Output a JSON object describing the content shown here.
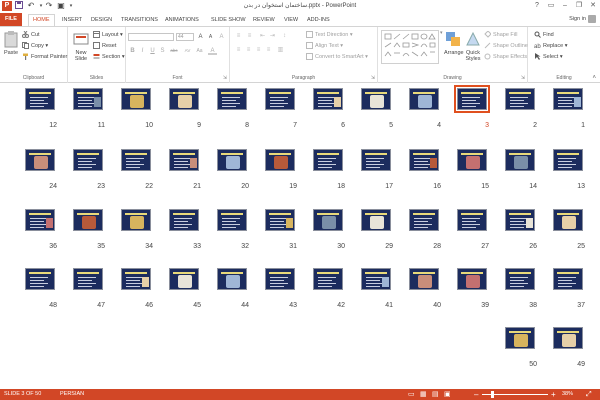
{
  "window": {
    "title": "ساختمان استخوان در بدن.pptx - PowerPoint",
    "help": "?",
    "minimize": "–",
    "restore": "❐",
    "close": "✕",
    "undo": "↶",
    "redo": "↷",
    "start": "▣"
  },
  "tabs": [
    "FILE",
    "HOME",
    "INSERT",
    "DESIGN",
    "TRANSITIONS",
    "ANIMATIONS",
    "SLIDE SHOW",
    "REVIEW",
    "VIEW",
    "ADD-INS"
  ],
  "active_tab": "HOME",
  "signin": "Sign in",
  "ribbon": {
    "clipboard": {
      "label": "Clipboard",
      "paste": "Paste",
      "cut": "Cut",
      "copy": "Copy",
      "format_painter": "Format Painter"
    },
    "slides": {
      "label": "Slides",
      "new_slide": "New",
      "new_slide2": "Slide",
      "layout": "Layout",
      "reset": "Reset",
      "section": "Section"
    },
    "font": {
      "label": "Font",
      "size": "44",
      "bold": "B",
      "italic": "I",
      "underline": "U",
      "strike": "S",
      "shadow": "abc",
      "spacing": "AV",
      "case": "Aa",
      "color": "A",
      "grow": "A",
      "shrink": "A",
      "clear": "A"
    },
    "paragraph": {
      "label": "Paragraph",
      "text_direction": "Text Direction",
      "align_text": "Align Text",
      "smartart": "Convert to SmartArt"
    },
    "drawing": {
      "label": "Drawing",
      "arrange": "Arrange",
      "quick_styles": "Quick",
      "quick_styles2": "Styles",
      "shape_fill": "Shape Fill",
      "shape_outline": "Shape Outline",
      "shape_effects": "Shape Effects"
    },
    "editing": {
      "label": "Editing",
      "find": "Find",
      "replace": "Replace",
      "select": "Select"
    }
  },
  "slides": {
    "selected": 3,
    "numbers": [
      "1",
      "2",
      "3",
      "4",
      "5",
      "6",
      "7",
      "8",
      "9",
      "10",
      "11",
      "12",
      "13",
      "14",
      "15",
      "16",
      "17",
      "18",
      "19",
      "20",
      "21",
      "22",
      "23",
      "24",
      "25",
      "26",
      "27",
      "28",
      "29",
      "30",
      "31",
      "32",
      "33",
      "34",
      "35",
      "36",
      "37",
      "38",
      "39",
      "40",
      "41",
      "42",
      "43",
      "44",
      "45",
      "46",
      "47",
      "48",
      "49",
      "50"
    ]
  },
  "status": {
    "slide_of": "SLIDE 3 OF 50",
    "language": "PERSIAN",
    "zoom": "38%",
    "zoom_minus": "–",
    "zoom_plus": "+",
    "zoom_level": 0.38
  },
  "colors": {
    "accent": "#d24726",
    "slide_bg": "#1c2c5e",
    "selection": "#e0501f"
  }
}
